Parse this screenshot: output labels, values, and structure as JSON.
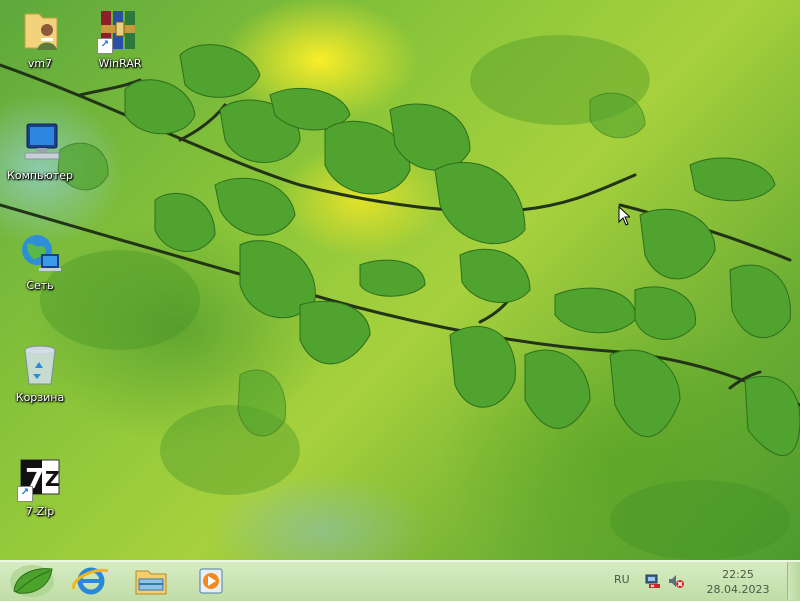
{
  "desktop": {
    "icons": [
      {
        "label": "vm7",
        "icon": "user-folder-icon"
      },
      {
        "label": "WinRAR",
        "icon": "winrar-archive-icon"
      },
      {
        "label": "Компьютер",
        "icon": "computer-icon"
      },
      {
        "label": "Сеть",
        "icon": "network-icon"
      },
      {
        "label": "Корзина",
        "icon": "recycle-bin-icon"
      },
      {
        "label": "7-Zip",
        "icon": "7zip-icon"
      }
    ]
  },
  "taskbar": {
    "pinned": [
      {
        "name": "start",
        "icon": "leaf-start-icon"
      },
      {
        "name": "internet-explorer",
        "icon": "internet-explorer-icon"
      },
      {
        "name": "file-explorer",
        "icon": "file-explorer-icon"
      },
      {
        "name": "media-player",
        "icon": "media-player-icon"
      }
    ],
    "tray": {
      "language": "RU",
      "network_icon": "network-status-icon",
      "volume_icon": "volume-muted-icon",
      "time": "22:25",
      "date": "28.04.2023"
    }
  },
  "colors": {
    "accent_green": "#7cbd3b",
    "taskbar_bg": "#cfe6bb"
  }
}
